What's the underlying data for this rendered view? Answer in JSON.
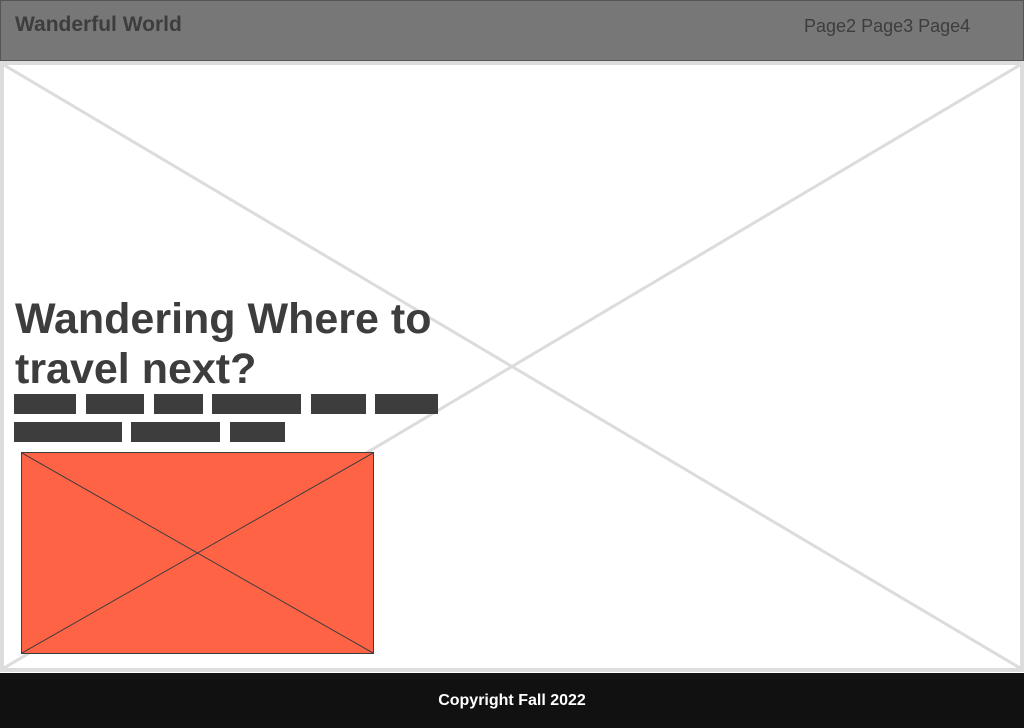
{
  "header": {
    "brand": "Wanderful World",
    "nav": [
      {
        "label": "Page2"
      },
      {
        "label": "Page3"
      },
      {
        "label": "Page4"
      }
    ]
  },
  "hero": {
    "headline": "Wandering Where to travel next?"
  },
  "footer": {
    "copyright": "Copyright Fall 2022"
  },
  "colors": {
    "header_bg": "#777777",
    "text_dark": "#3d3d3d",
    "placeholder_border": "#dcdcdc",
    "thumb_fill": "#ff6346",
    "footer_bg": "#111111",
    "footer_text": "#ffffff"
  },
  "icons": {
    "hero_image": "image-placeholder-icon",
    "thumbnail_image": "image-placeholder-icon"
  }
}
